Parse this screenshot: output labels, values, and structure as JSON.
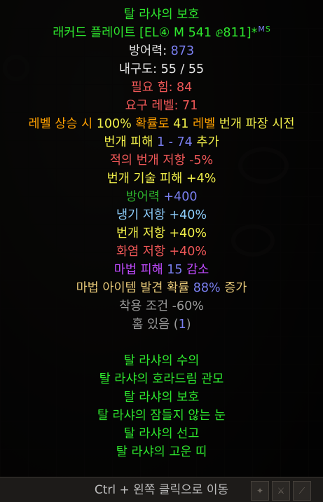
{
  "tooltip": {
    "title_1": "탈 라샤의 보호",
    "title_2_base": "래커드 플레이트",
    "title_2_meta": "[EL④ M 541 ⅇ811]",
    "title_2_star": "*",
    "title_2_icon_m": "M",
    "title_2_icon_s": "S",
    "defense_label": "방어력: ",
    "defense_value": "873",
    "durability": "내구도: 55 / 55",
    "req_str": "필요 힘: 84",
    "req_lvl": "요구 레벨: 71",
    "proc_a": "레벨 상승 시 ",
    "proc_pct": "100%",
    "proc_b": " 확률로 ",
    "proc_lvl": "41",
    "proc_c": " 레벨 ",
    "proc_skill": "번개 파장 시전",
    "lightning_dmg_a": "번개 피해 ",
    "lightning_dmg_value": "1 - 74",
    "lightning_dmg_b": " 추가",
    "enemy_res": "적의 번개 저항 -5%",
    "lightning_skill": "번개 기술 피해 +4%",
    "defense_bonus_a": "방어력 ",
    "defense_bonus_value": "+400",
    "cold_res": "냉기 저항 +40%",
    "light_res": "번개 저항 +40%",
    "fire_res": "화염 저항 +40%",
    "magic_dmg_a": "마법 피해 ",
    "magic_dmg_value": "15",
    "magic_dmg_b": " 감소",
    "mf_a": "마법 아이템 발견 확률 ",
    "mf_value": "88%",
    "mf_b": " 증가",
    "req_reduction": "착용 조건 -60%",
    "sockets_a": "홈 있음 (",
    "sockets_value": "1",
    "sockets_b": ")",
    "set_items": [
      "탈 라샤의 수의",
      "탈 라샤의 호라드림 관모",
      "탈 라샤의 보호",
      "탈 라샤의 잠들지 않는 눈",
      "탈 라샤의 선고",
      "탈 라샤의 고운 띠"
    ]
  },
  "bottom": {
    "hint": "Ctrl + 왼쪽 클릭으로 이동"
  },
  "colors": {
    "set_green": "#2ee82e",
    "magic_blue": "#7a7ff0",
    "red": "#ee5757",
    "yellow": "#f2f04a",
    "orange": "#ffa000",
    "purple": "#c14bff",
    "gray": "#9a9a9a"
  }
}
